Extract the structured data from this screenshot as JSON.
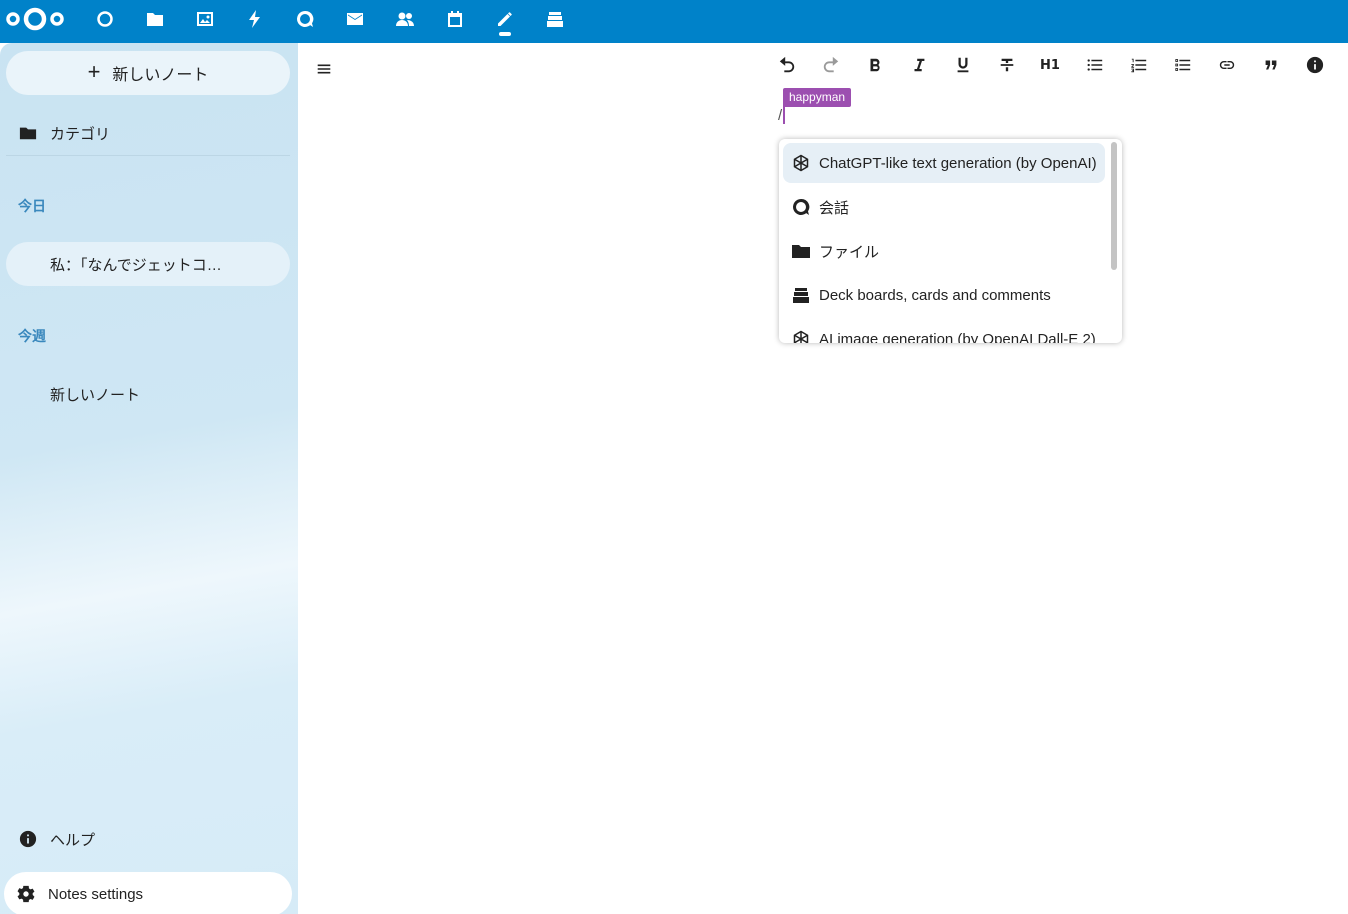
{
  "topbar": {
    "apps": [
      "dashboard-icon",
      "files-icon",
      "photos-icon",
      "activity-icon",
      "talk-icon",
      "mail-icon",
      "contacts-icon",
      "calendar-icon",
      "notes-icon",
      "deck-icon"
    ],
    "active_app": "notes",
    "color": "#0082c9"
  },
  "sidebar": {
    "new_note": "新しいノート",
    "categories": "カテゴリ",
    "sections": [
      {
        "caption": "今日",
        "notes": [
          "私：「なんでジェットコ…"
        ]
      },
      {
        "caption": "今週",
        "notes": [
          "新しいノート"
        ]
      }
    ],
    "help": "ヘルプ",
    "settings": "Notes settings"
  },
  "editor": {
    "toolbar": [
      "undo-icon",
      "redo-icon",
      "bold-icon",
      "italic-icon",
      "underline-icon",
      "strikethrough-icon",
      "H1",
      "bullet-list-icon",
      "numbered-list-icon",
      "checklist-icon",
      "link-icon",
      "blockquote-icon",
      "info-icon"
    ],
    "user_tag": "happyman",
    "typed_text": "/"
  },
  "suggestions": [
    {
      "icon": "openai-icon",
      "label": "ChatGPT-like text generation (by OpenAI)",
      "selected": true
    },
    {
      "icon": "talk-icon",
      "label": "会話"
    },
    {
      "icon": "folder-icon",
      "label": "ファイル"
    },
    {
      "icon": "deck-icon",
      "label": "Deck boards, cards and comments"
    },
    {
      "icon": "openai-icon",
      "label": "AI image generation (by OpenAI Dall-E 2)"
    }
  ],
  "colors": {
    "accent": "#0082c9",
    "user": "#9c4fb0",
    "caption": "#3a88bd"
  }
}
